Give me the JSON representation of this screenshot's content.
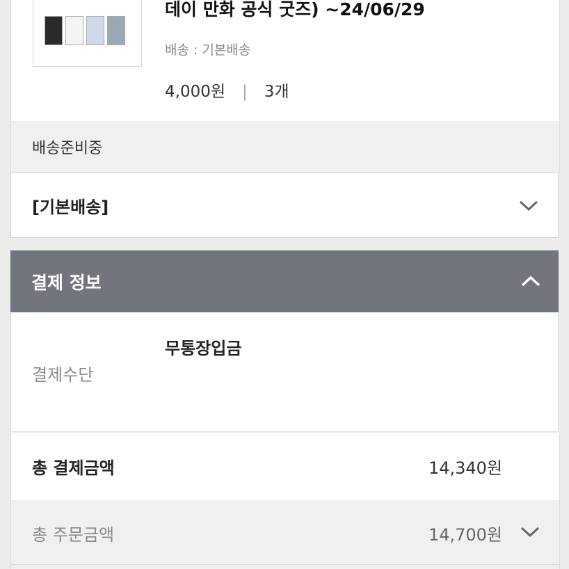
{
  "product": {
    "title": "데이 만화 공식 굿즈) ~24/06/29",
    "shipping": "배송 : 기본배송",
    "price": "4,000원",
    "separator": "|",
    "quantity": "3개"
  },
  "status": "배송준비중",
  "delivery": {
    "label": "[기본배송]",
    "icon": "chevron-down-icon"
  },
  "payment": {
    "header": "결제 정보",
    "header_icon": "chevron-up-icon",
    "method_label": "결제수단",
    "method_value": "무통장입금",
    "total_payment_label": "총 결제금액",
    "total_payment_value": "14,340원",
    "total_order_label": "총 주문금액",
    "total_order_value": "14,700원",
    "total_order_icon": "chevron-down-icon"
  },
  "colors": {
    "header_bg": "#72757d",
    "band_bg": "#f0f0f0"
  }
}
